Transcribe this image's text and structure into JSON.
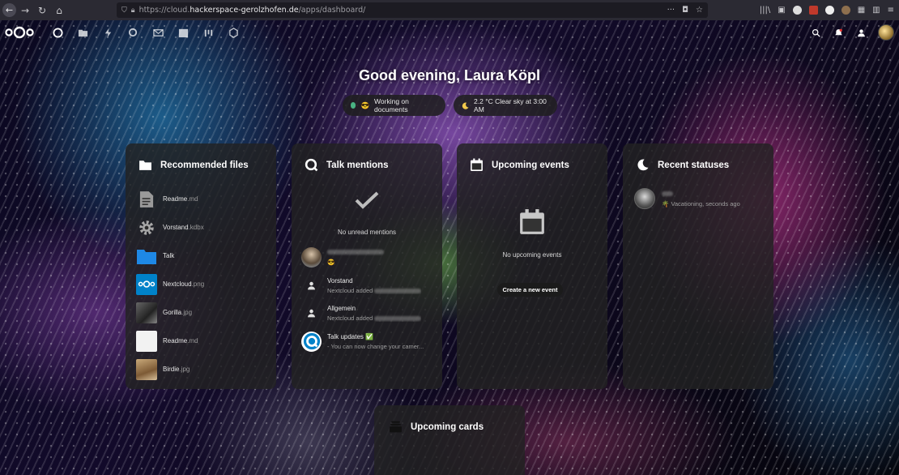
{
  "browser": {
    "url_prefix": "https://cloud.",
    "url_host": "hackerspace-gerolzhofen.de",
    "url_path": "/apps/dashboard/",
    "more": "···"
  },
  "greeting": "Good evening, Laura Köpl",
  "status_pill": {
    "emoji": "😎",
    "label": "Working on documents"
  },
  "weather_pill": {
    "label": "2.2 °C Clear sky at 3:00 AM"
  },
  "colors": {
    "online": "#49b382",
    "panel": "#222222",
    "files_blue": "#1e88e5"
  },
  "recommended_files": {
    "title": "Recommended files",
    "items": [
      {
        "name": "Readme",
        "ext": ".md",
        "icon": "document-icon"
      },
      {
        "name": "Vorstand",
        "ext": ".kdbx",
        "icon": "gear-icon"
      },
      {
        "name": "Talk",
        "ext": "",
        "icon": "folder-icon"
      },
      {
        "name": "Nextcloud",
        "ext": ".png",
        "icon": "nextcloud-logo-icon"
      },
      {
        "name": "Gorilla",
        "ext": ".jpg",
        "icon": "image-thumbnail"
      },
      {
        "name": "Readme",
        "ext": ".md",
        "icon": "blank-document-icon"
      },
      {
        "name": "Birdie",
        "ext": ".jpg",
        "icon": "image-thumbnail"
      }
    ]
  },
  "talk_mentions": {
    "title": "Talk mentions",
    "empty_label": "No unread mentions",
    "items": [
      {
        "title": "",
        "subtitle": "😎"
      },
      {
        "title": "Vorstand",
        "subtitle": "Nextcloud added"
      },
      {
        "title": "Allgemein",
        "subtitle": "Nextcloud added"
      },
      {
        "title": "Talk updates ✅",
        "subtitle": "- You can now change your camer..."
      }
    ]
  },
  "upcoming_events": {
    "title": "Upcoming events",
    "empty_label": "No upcoming events",
    "create_button": "Create a new event"
  },
  "recent_statuses": {
    "title": "Recent statuses",
    "items": [
      {
        "emoji": "🌴",
        "label": "Vacationing, seconds ago"
      }
    ]
  },
  "upcoming_cards": {
    "title": "Upcoming cards"
  }
}
